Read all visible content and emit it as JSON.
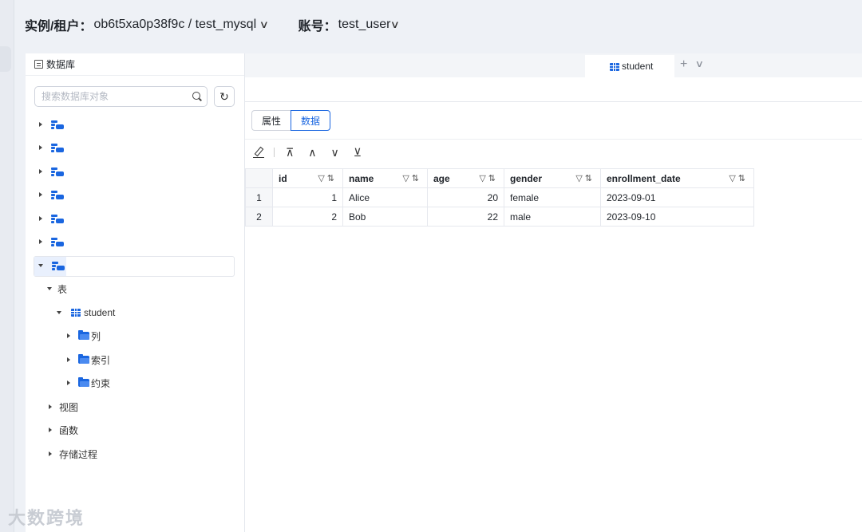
{
  "topbar": {
    "instance_label": "实例/租户：",
    "instance_value": "ob6t5xa0p38f9c / test_mysql",
    "account_label": "账号：",
    "account_value": "test_user"
  },
  "sidebar": {
    "title": "数据库",
    "search_placeholder": "搜索数据库对象",
    "tree": {
      "tables_label": "表",
      "table_name": "student",
      "columns_label": "列",
      "indexes_label": "索引",
      "constraints_label": "约束",
      "views_label": "视图",
      "functions_label": "函数",
      "procedures_label": "存储过程"
    }
  },
  "tabs": {
    "active_tab": "student"
  },
  "segment": {
    "properties_label": "属性",
    "data_label": "数据",
    "active": "数据"
  },
  "grid": {
    "columns": [
      "id",
      "name",
      "age",
      "gender",
      "enrollment_date"
    ],
    "rows": [
      {
        "rn": "1",
        "id": "1",
        "name": "Alice",
        "age": "20",
        "gender": "female",
        "enrollment_date": "2023-09-01"
      },
      {
        "rn": "2",
        "id": "2",
        "name": "Bob",
        "age": "22",
        "gender": "male",
        "enrollment_date": "2023-09-10"
      }
    ]
  },
  "watermark": "大数跨境",
  "colors": {
    "accent": "#1a66e0",
    "background": "#eef1f6"
  }
}
